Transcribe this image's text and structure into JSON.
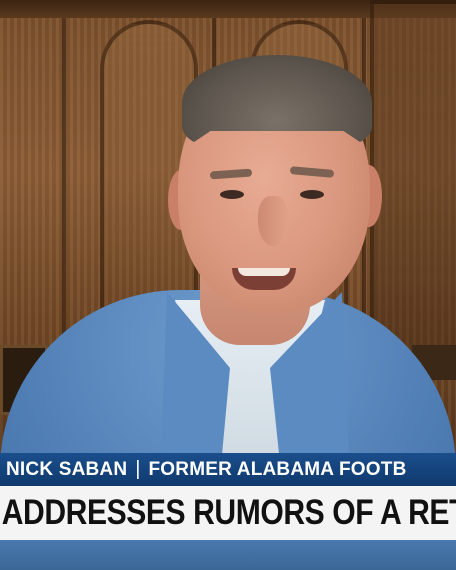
{
  "lower_third": {
    "name": "NICK SABAN",
    "separator": "|",
    "role": "FORMER ALABAMA FOOTB",
    "headline": "ADDRESSES RUMORS OF A RETURN"
  },
  "colors": {
    "name_bar": "#0f3a6d",
    "headline_bar": "#f4f4f4",
    "headline_text": "#111111",
    "name_text": "#ffffff"
  }
}
